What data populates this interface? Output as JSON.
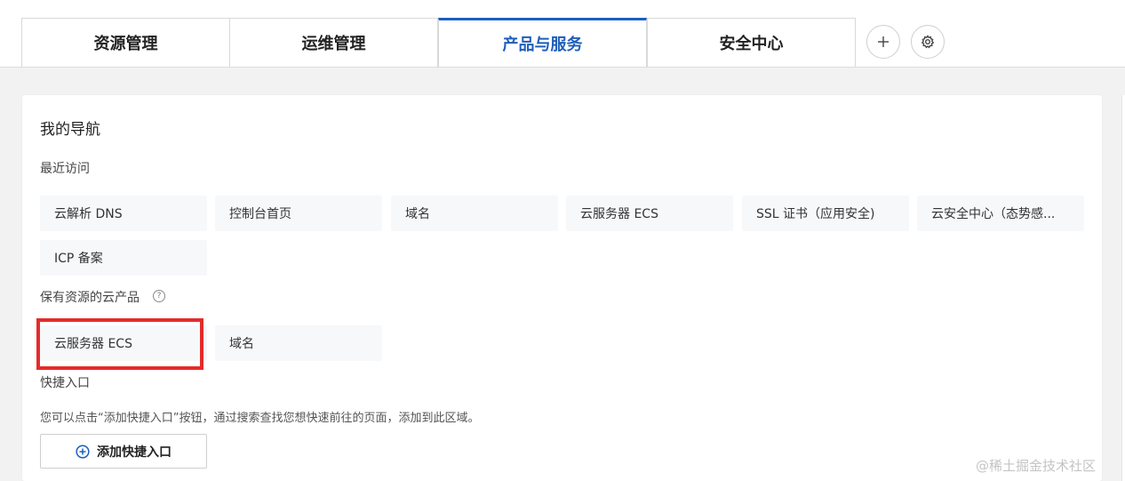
{
  "tabs": [
    {
      "label": "资源管理",
      "active": false
    },
    {
      "label": "运维管理",
      "active": false
    },
    {
      "label": "产品与服务",
      "active": true
    },
    {
      "label": "安全中心",
      "active": false
    }
  ],
  "toolbar": {
    "add_icon": "plus-icon",
    "settings_icon": "gear-icon"
  },
  "panel": {
    "title": "我的导航",
    "recent": {
      "label": "最近访问",
      "items": [
        "云解析 DNS",
        "控制台首页",
        "域名",
        "云服务器 ECS",
        "SSL 证书（应用安全)",
        "云安全中心（态势感...",
        "ICP 备案"
      ]
    },
    "owned": {
      "label": "保有资源的云产品",
      "help_icon": "question-circle-icon",
      "items": [
        "云服务器 ECS",
        "域名"
      ]
    },
    "shortcuts": {
      "label": "快捷入口",
      "description": "您可以点击“添加快捷入口”按钮，通过搜索查找您想快速前往的页面，添加到此区域。",
      "button_label": "添加快捷入口",
      "button_icon": "plus-circle-icon"
    }
  },
  "watermark": "@稀土掘金技术社区",
  "colors": {
    "accent": "#1a5fc0",
    "highlight": "#e52b2b",
    "chip_bg": "#f7f8fa",
    "page_bg": "#f2f2f2"
  }
}
